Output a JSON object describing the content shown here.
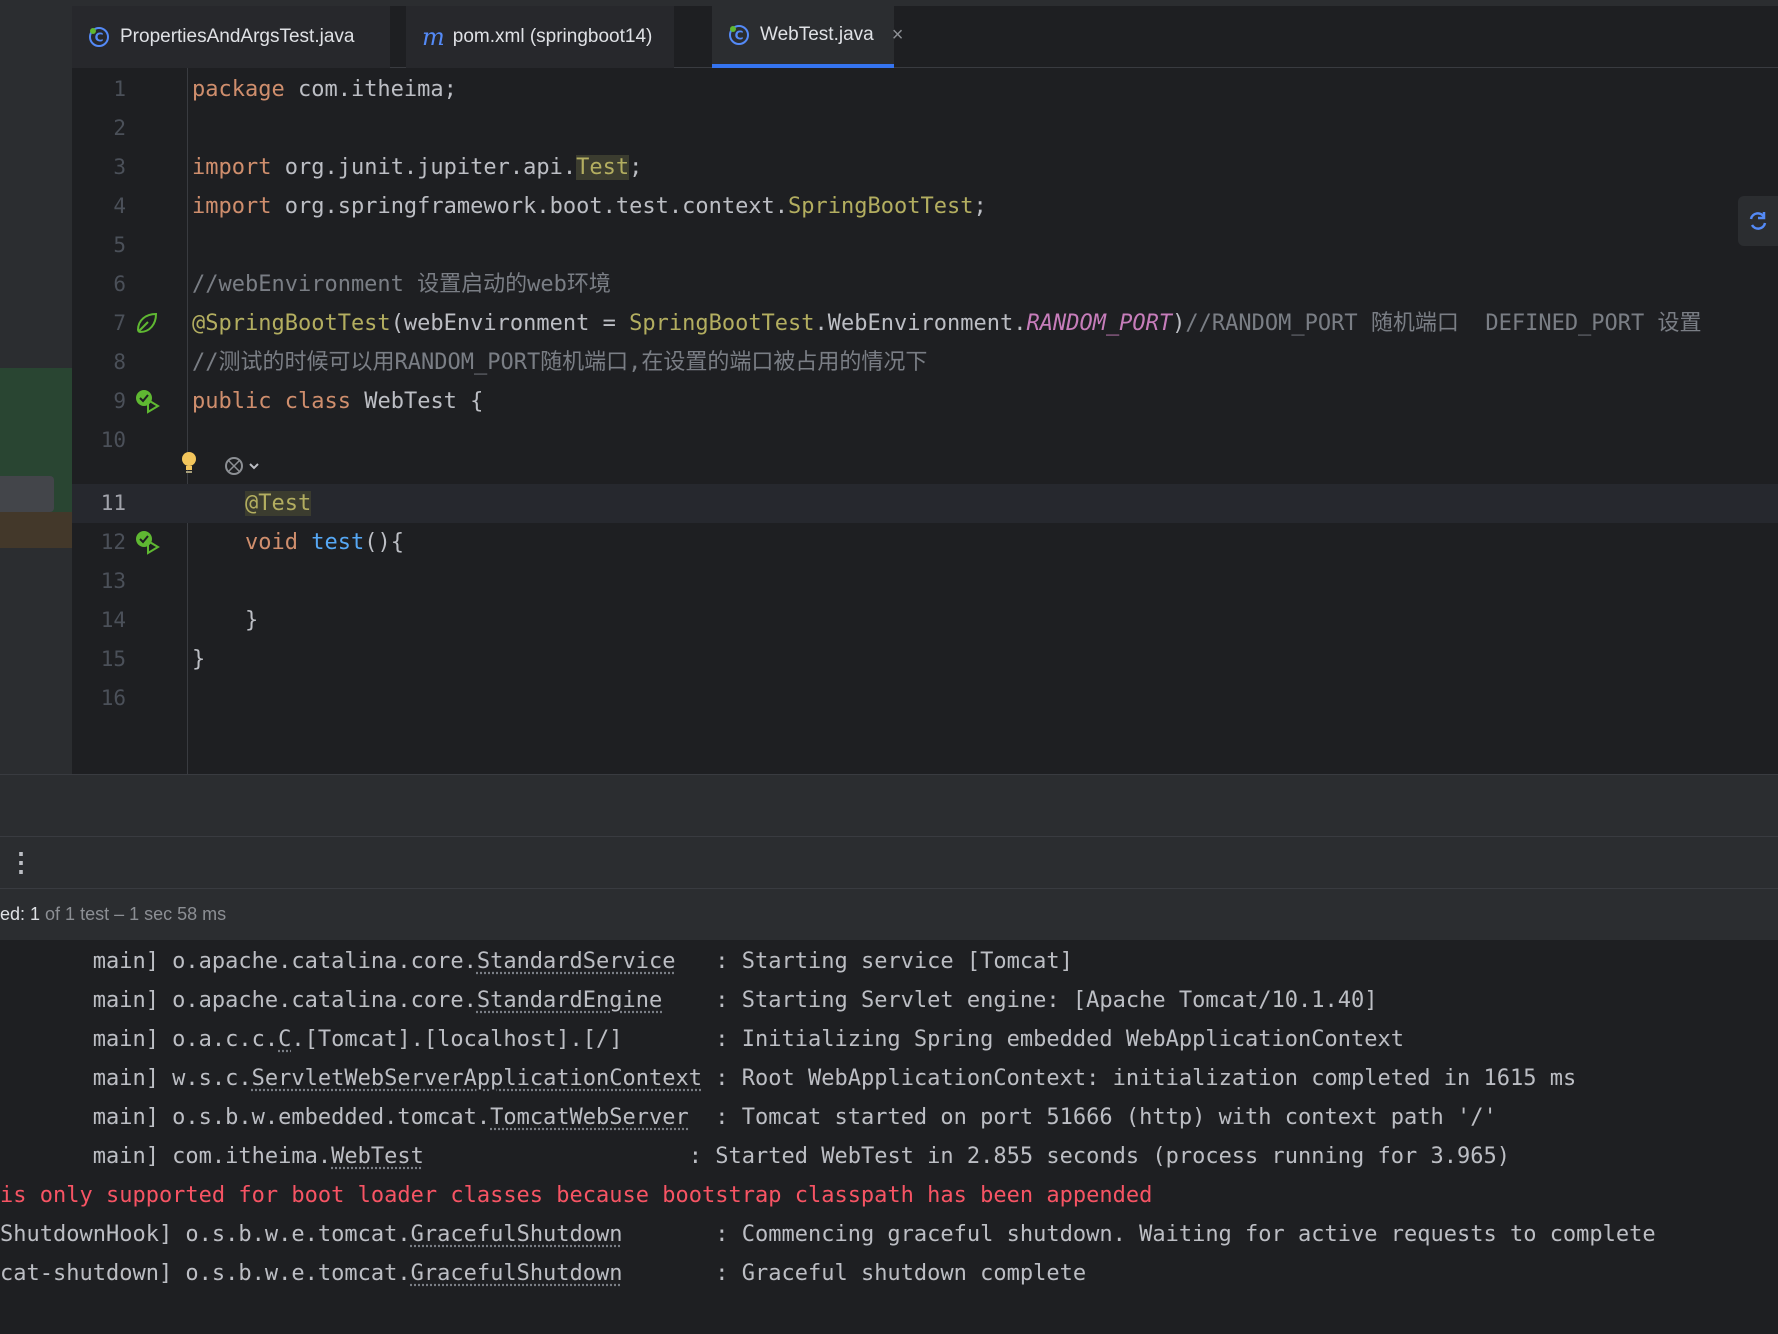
{
  "tabs": [
    {
      "label": "PropertiesAndArgsTest.java",
      "icon": "java-class-icon",
      "active": false
    },
    {
      "label": "pom.xml (springboot14)",
      "icon": "maven-icon",
      "active": false
    },
    {
      "label": "WebTest.java",
      "icon": "java-class-icon",
      "active": true
    }
  ],
  "tab_close": "×",
  "maven_glyph": "m",
  "editor": {
    "line_numbers": [
      "1",
      "2",
      "3",
      "4",
      "5",
      "6",
      "7",
      "8",
      "9",
      "10",
      "11",
      "12",
      "13",
      "14",
      "15",
      "16"
    ],
    "tokens": {
      "package": "package",
      "pkg_name": " com.itheima;",
      "import": "import",
      "imp1_pre": " org.junit.jupiter.api.",
      "imp1_cls": "Test",
      "semi": ";",
      "imp2_pre": " org.springframework.boot.test.context.",
      "imp2_cls": "SpringBootTest",
      "cmt6": "//webEnvironment 设置启动的web环境",
      "ann7": "@SpringBootTest",
      "l7_a": "(webEnvironment = ",
      "l7_cls": "SpringBootTest",
      "l7_b": ".WebEnvironment.",
      "l7_const": "RANDOM_PORT",
      "l7_paren": ")",
      "l7_cmt": "//RANDOM_PORT 随机端口  DEFINED_PORT 设置",
      "cmt8": "//测试的时候可以用RANDOM_PORT随机端口,在设置的端口被占用的情况下",
      "public": "public",
      "class": "class",
      "class_name": " WebTest {",
      "test_ann": "@Test",
      "void": "void",
      "method": "test",
      "method_rest": "(){",
      "close_brace_inner": "}",
      "close_brace_outer": "}",
      "indent": "    ",
      "space": " "
    }
  },
  "status": {
    "prefix": "ed: ",
    "passed": "1",
    "rest": " of 1 test – 1 sec 58 ms"
  },
  "console": [
    {
      "pre": "       main] o.apache.catalina.core.",
      "u": "StandardService",
      "post": "   : Starting service [Tomcat]"
    },
    {
      "pre": "       main] o.apache.catalina.core.",
      "u": "StandardEngine",
      "post": "    : Starting Servlet engine: [Apache Tomcat/10.1.40]"
    },
    {
      "pre": "       main] o.a.c.c.",
      "u": "C",
      "post": ".[Tomcat].[localhost].[/]       : Initializing Spring embedded WebApplicationContext"
    },
    {
      "pre": "       main] w.s.c.",
      "u": "ServletWebServerApplicationContext",
      "post": " : Root WebApplicationContext: initialization completed in 1615 ms"
    },
    {
      "pre": "       main] o.s.b.w.embedded.tomcat.",
      "u": "TomcatWebServer",
      "post": "  : Tomcat started on port 51666 (http) with context path '/'"
    },
    {
      "pre": "       main] com.itheima.",
      "u": "WebTest",
      "post": "                    : Started WebTest in 2.855 seconds (process running for 3.965)"
    },
    {
      "pre": "is only supported for boot loader classes because bootstrap classpath has been appended",
      "u": "",
      "post": ""
    },
    {
      "pre": "ShutdownHook] o.s.b.w.e.tomcat.",
      "u": "GracefulShutdown",
      "post": "       : Commencing graceful shutdown. Waiting for active requests to complete"
    },
    {
      "pre": "cat-shutdown] o.s.b.w.e.tomcat.",
      "u": "GracefulShutdown",
      "post": "       : Graceful shutdown complete"
    }
  ],
  "colors": {
    "background": "#1e1f22",
    "keyword": "#cf8e6d",
    "annotation": "#b3ae60",
    "comment": "#7a7e85",
    "constant": "#c77dbb",
    "function": "#56a8f5",
    "error": "#f75464",
    "accent": "#3574f0"
  }
}
